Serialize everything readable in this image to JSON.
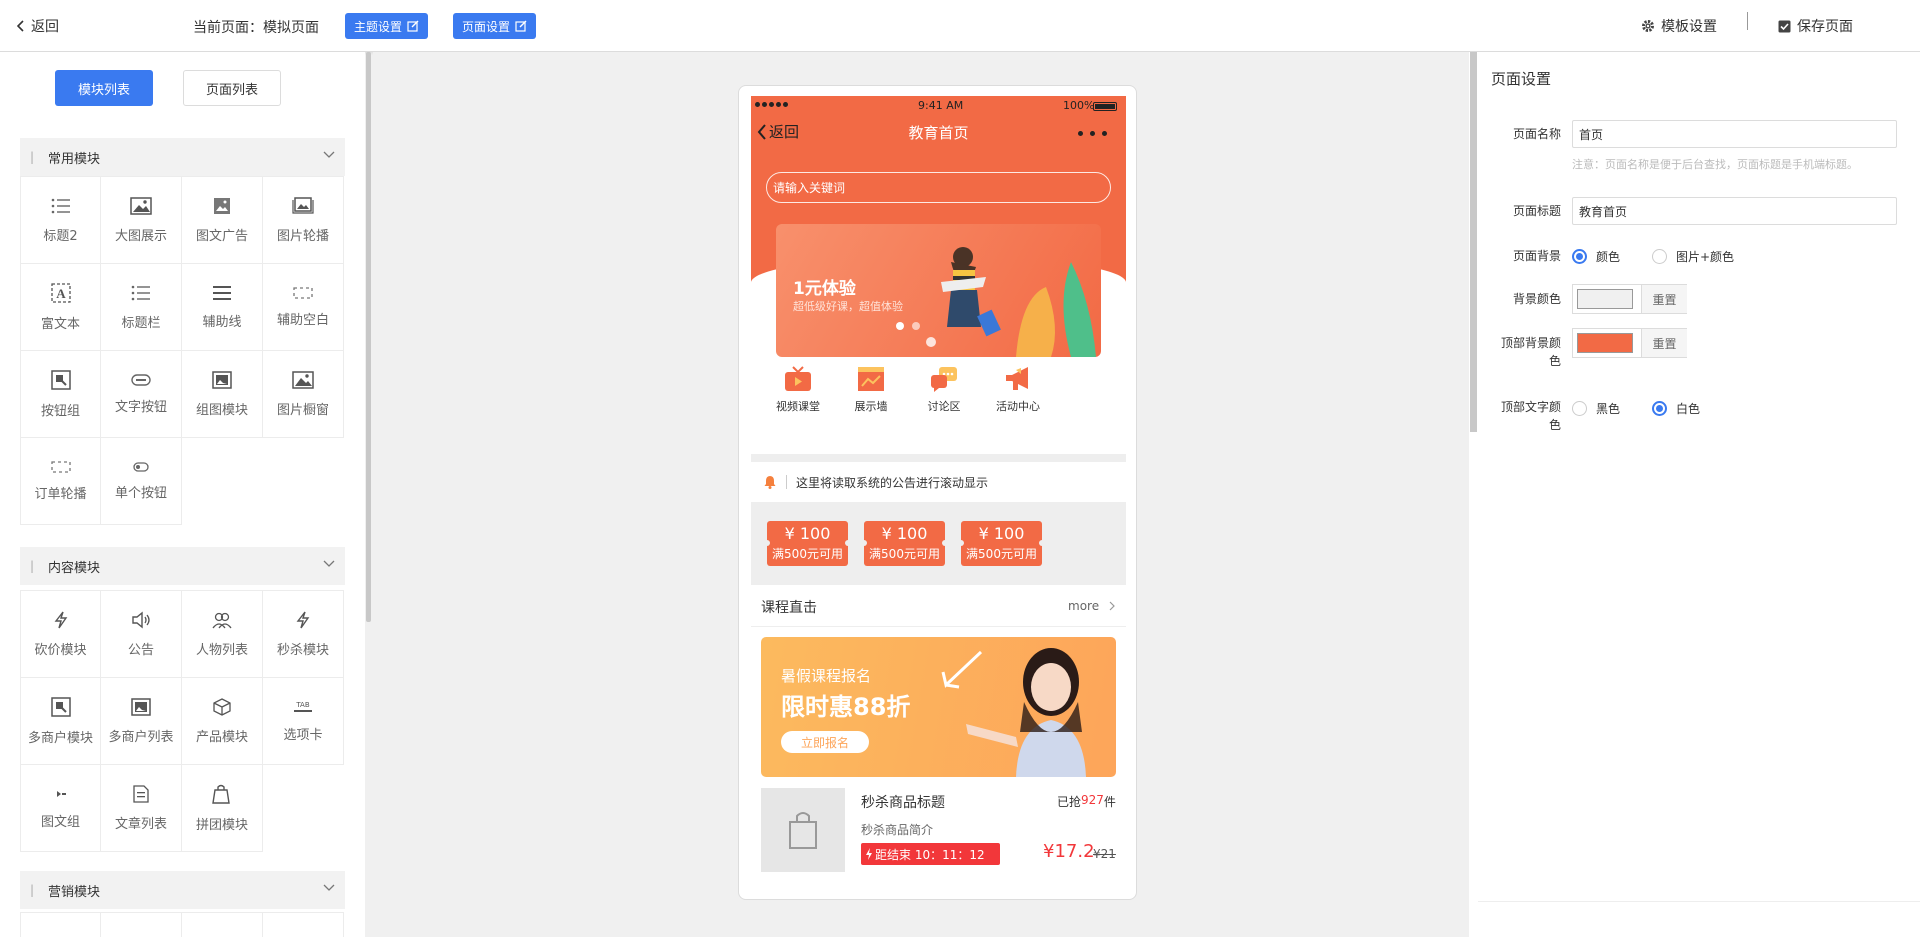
{
  "topbar": {
    "back_label": "返回",
    "current_page": "当前页面：模拟页面",
    "theme_btn": "主题设置",
    "page_btn": "页面设置",
    "template_settings": "模板设置",
    "save_page": "保存页面"
  },
  "left": {
    "tabs": [
      "模块列表",
      "页面列表"
    ],
    "sections": [
      {
        "title": "常用模块",
        "items": [
          {
            "label": "标题2",
            "icon": "list-icon"
          },
          {
            "label": "大图展示",
            "icon": "image-icon"
          },
          {
            "label": "图文广告",
            "icon": "image-ad-icon"
          },
          {
            "label": "图片轮播",
            "icon": "carousel-icon"
          },
          {
            "label": "富文本",
            "icon": "richtext-icon"
          },
          {
            "label": "标题栏",
            "icon": "list-icon"
          },
          {
            "label": "辅助线",
            "icon": "divider-icon"
          },
          {
            "label": "辅助空白",
            "icon": "blank-icon"
          },
          {
            "label": "按钮组",
            "icon": "button-group-icon"
          },
          {
            "label": "文字按钮",
            "icon": "text-button-icon"
          },
          {
            "label": "组图模块",
            "icon": "gallery-icon"
          },
          {
            "label": "图片橱窗",
            "icon": "image-window-icon"
          },
          {
            "label": "订单轮播",
            "icon": "blank-icon"
          },
          {
            "label": "单个按钮",
            "icon": "single-button-icon"
          }
        ]
      },
      {
        "title": "内容模块",
        "items": [
          {
            "label": "砍价模块",
            "icon": "flash-icon"
          },
          {
            "label": "公告",
            "icon": "speaker-icon"
          },
          {
            "label": "人物列表",
            "icon": "people-icon"
          },
          {
            "label": "秒杀模块",
            "icon": "flash-icon"
          },
          {
            "label": "多商户模块",
            "icon": "button-group-icon"
          },
          {
            "label": "多商户列表",
            "icon": "gallery-icon"
          },
          {
            "label": "产品模块",
            "icon": "cube-icon"
          },
          {
            "label": "选项卡",
            "icon": "tab-icon"
          },
          {
            "label": "图文组",
            "icon": "small-icon"
          },
          {
            "label": "文章列表",
            "icon": "article-icon"
          },
          {
            "label": "拼团模块",
            "icon": "tag-icon"
          }
        ]
      },
      {
        "title": "营销模块",
        "items": []
      }
    ]
  },
  "phone": {
    "status_time": "9:41 AM",
    "status_battery": "100%",
    "nav_back": "返回",
    "nav_title": "教育首页",
    "search_placeholder": "请输入关键词",
    "banner_title": "1元体验",
    "banner_sub": "超低级好课，超值体验",
    "nav_items": [
      "视频课堂",
      "展示墙",
      "讨论区",
      "活动中心"
    ],
    "notice": "这里将读取系统的公告进行滚动显示",
    "coupons": [
      {
        "amount": "¥ 100",
        "cond": "满500元可用"
      },
      {
        "amount": "¥ 100",
        "cond": "满500元可用"
      },
      {
        "amount": "¥ 100",
        "cond": "满500元可用"
      }
    ],
    "course_title": "课程直击",
    "course_more": "more",
    "promo_top": "暑假课程报名",
    "promo_big": "限时惠88折",
    "promo_btn": "立即报名",
    "product_title": "秒杀商品标题",
    "product_sold_prefix": "已抢",
    "product_sold": "927",
    "product_sold_suffix": "件",
    "product_sub": "秒杀商品简介",
    "countdown": "距结束 10：11：12",
    "price": "¥17.2",
    "price_old": "¥21"
  },
  "right": {
    "title": "页面设置",
    "page_name_label": "页面名称",
    "page_name_value": "首页",
    "note": "注意：页面名称是便于后台查找，页面标题是手机端标题。",
    "page_title_label": "页面标题",
    "page_title_value": "教育首页",
    "bg_label": "页面背景",
    "bg_opt1": "颜色",
    "bg_opt2": "图片+颜色",
    "bg_color_label": "背景颜色",
    "reset": "重置",
    "top_bg_label": "顶部背景颜色",
    "top_text_label": "顶部文字颜色",
    "text_opt1": "黑色",
    "text_opt2": "白色"
  },
  "colors": {
    "accent": "#3a7af0",
    "brand": "#f26a45",
    "price": "#f2373a"
  }
}
